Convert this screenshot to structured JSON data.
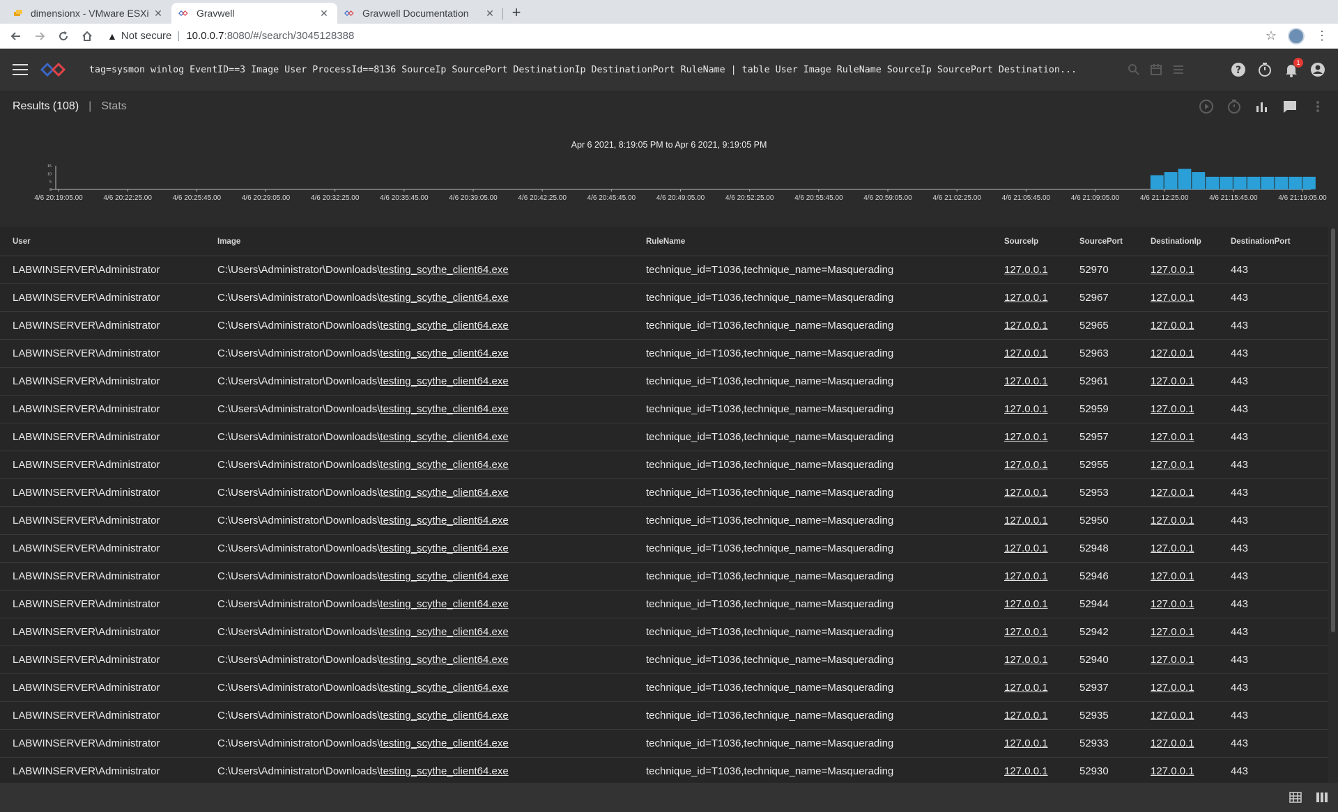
{
  "browser": {
    "tabs": [
      {
        "title": "dimensionx - VMware ESXi",
        "active": false
      },
      {
        "title": "Gravwell",
        "active": true
      },
      {
        "title": "Gravwell Documentation",
        "active": false
      }
    ],
    "new_tab": "+",
    "address": {
      "security": "Not secure",
      "host": "10.0.0.7",
      "path": ":8080/#/search/3045128388"
    }
  },
  "app": {
    "query": "tag=sysmon winlog EventID==3 Image User ProcessId==8136 SourceIp SourcePort DestinationIp DestinationPort RuleName | table User Image RuleName SourceIp SourcePort Destination...",
    "notification_count": "1",
    "colors": {
      "accent": "#2a9fd8",
      "logo_red": "#e2434b",
      "logo_blue": "#3a66c4"
    }
  },
  "results_bar": {
    "results_label": "Results (108)",
    "divider": "|",
    "stats_label": "Stats"
  },
  "overview": {
    "range_label": "Apr 6 2021, 8:19:05 PM to Apr 6 2021, 9:19:05 PM"
  },
  "chart_data": {
    "type": "bar",
    "title": "Apr 6 2021, 8:19:05 PM to Apr 6 2021, 9:19:05 PM",
    "xlabel": "",
    "ylabel": "",
    "y_ticks": [
      "15",
      "10",
      "5",
      "0"
    ],
    "ylim": [
      0,
      15
    ],
    "x_tick_labels": [
      "4/6 20:19:05.00",
      "4/6 20:22:25.00",
      "4/6 20:25:45.00",
      "4/6 20:29:05.00",
      "4/6 20:32:25.00",
      "4/6 20:35:45.00",
      "4/6 20:39:05.00",
      "4/6 20:42:25.00",
      "4/6 20:45:45.00",
      "4/6 20:49:05.00",
      "4/6 20:52:25.00",
      "4/6 20:55:45.00",
      "4/6 20:59:05.00",
      "4/6 21:02:25.00",
      "4/6 21:05:45.00",
      "4/6 21:09:05.00",
      "4/6 21:12:25.00",
      "4/6 21:15:45.00",
      "4/6 21:19:05.00"
    ],
    "bins_total": 90,
    "first_nonzero_bin": 79,
    "values": [
      9,
      11,
      13,
      11,
      8,
      8,
      8,
      8,
      8,
      8,
      8,
      8
    ],
    "color": "#2a9fd8"
  },
  "table": {
    "columns": [
      "User",
      "Image",
      "RuleName",
      "SourceIp",
      "SourcePort",
      "DestinationIp",
      "DestinationPort"
    ],
    "image_prefix": "C:\\Users\\Administrator\\Downloads\\",
    "rows": [
      {
        "user": "LABWINSERVER\\Administrator",
        "image_file": "testing_scythe_client64.exe",
        "rule": "technique_id=T1036,technique_name=Masquerading",
        "sip": "127.0.0.1",
        "sport": "52970",
        "dip": "127.0.0.1",
        "dport": "443"
      },
      {
        "user": "LABWINSERVER\\Administrator",
        "image_file": "testing_scythe_client64.exe",
        "rule": "technique_id=T1036,technique_name=Masquerading",
        "sip": "127.0.0.1",
        "sport": "52967",
        "dip": "127.0.0.1",
        "dport": "443"
      },
      {
        "user": "LABWINSERVER\\Administrator",
        "image_file": "testing_scythe_client64.exe",
        "rule": "technique_id=T1036,technique_name=Masquerading",
        "sip": "127.0.0.1",
        "sport": "52965",
        "dip": "127.0.0.1",
        "dport": "443"
      },
      {
        "user": "LABWINSERVER\\Administrator",
        "image_file": "testing_scythe_client64.exe",
        "rule": "technique_id=T1036,technique_name=Masquerading",
        "sip": "127.0.0.1",
        "sport": "52963",
        "dip": "127.0.0.1",
        "dport": "443"
      },
      {
        "user": "LABWINSERVER\\Administrator",
        "image_file": "testing_scythe_client64.exe",
        "rule": "technique_id=T1036,technique_name=Masquerading",
        "sip": "127.0.0.1",
        "sport": "52961",
        "dip": "127.0.0.1",
        "dport": "443"
      },
      {
        "user": "LABWINSERVER\\Administrator",
        "image_file": "testing_scythe_client64.exe",
        "rule": "technique_id=T1036,technique_name=Masquerading",
        "sip": "127.0.0.1",
        "sport": "52959",
        "dip": "127.0.0.1",
        "dport": "443"
      },
      {
        "user": "LABWINSERVER\\Administrator",
        "image_file": "testing_scythe_client64.exe",
        "rule": "technique_id=T1036,technique_name=Masquerading",
        "sip": "127.0.0.1",
        "sport": "52957",
        "dip": "127.0.0.1",
        "dport": "443"
      },
      {
        "user": "LABWINSERVER\\Administrator",
        "image_file": "testing_scythe_client64.exe",
        "rule": "technique_id=T1036,technique_name=Masquerading",
        "sip": "127.0.0.1",
        "sport": "52955",
        "dip": "127.0.0.1",
        "dport": "443"
      },
      {
        "user": "LABWINSERVER\\Administrator",
        "image_file": "testing_scythe_client64.exe",
        "rule": "technique_id=T1036,technique_name=Masquerading",
        "sip": "127.0.0.1",
        "sport": "52953",
        "dip": "127.0.0.1",
        "dport": "443"
      },
      {
        "user": "LABWINSERVER\\Administrator",
        "image_file": "testing_scythe_client64.exe",
        "rule": "technique_id=T1036,technique_name=Masquerading",
        "sip": "127.0.0.1",
        "sport": "52950",
        "dip": "127.0.0.1",
        "dport": "443"
      },
      {
        "user": "LABWINSERVER\\Administrator",
        "image_file": "testing_scythe_client64.exe",
        "rule": "technique_id=T1036,technique_name=Masquerading",
        "sip": "127.0.0.1",
        "sport": "52948",
        "dip": "127.0.0.1",
        "dport": "443"
      },
      {
        "user": "LABWINSERVER\\Administrator",
        "image_file": "testing_scythe_client64.exe",
        "rule": "technique_id=T1036,technique_name=Masquerading",
        "sip": "127.0.0.1",
        "sport": "52946",
        "dip": "127.0.0.1",
        "dport": "443"
      },
      {
        "user": "LABWINSERVER\\Administrator",
        "image_file": "testing_scythe_client64.exe",
        "rule": "technique_id=T1036,technique_name=Masquerading",
        "sip": "127.0.0.1",
        "sport": "52944",
        "dip": "127.0.0.1",
        "dport": "443"
      },
      {
        "user": "LABWINSERVER\\Administrator",
        "image_file": "testing_scythe_client64.exe",
        "rule": "technique_id=T1036,technique_name=Masquerading",
        "sip": "127.0.0.1",
        "sport": "52942",
        "dip": "127.0.0.1",
        "dport": "443"
      },
      {
        "user": "LABWINSERVER\\Administrator",
        "image_file": "testing_scythe_client64.exe",
        "rule": "technique_id=T1036,technique_name=Masquerading",
        "sip": "127.0.0.1",
        "sport": "52940",
        "dip": "127.0.0.1",
        "dport": "443"
      },
      {
        "user": "LABWINSERVER\\Administrator",
        "image_file": "testing_scythe_client64.exe",
        "rule": "technique_id=T1036,technique_name=Masquerading",
        "sip": "127.0.0.1",
        "sport": "52937",
        "dip": "127.0.0.1",
        "dport": "443"
      },
      {
        "user": "LABWINSERVER\\Administrator",
        "image_file": "testing_scythe_client64.exe",
        "rule": "technique_id=T1036,technique_name=Masquerading",
        "sip": "127.0.0.1",
        "sport": "52935",
        "dip": "127.0.0.1",
        "dport": "443"
      },
      {
        "user": "LABWINSERVER\\Administrator",
        "image_file": "testing_scythe_client64.exe",
        "rule": "technique_id=T1036,technique_name=Masquerading",
        "sip": "127.0.0.1",
        "sport": "52933",
        "dip": "127.0.0.1",
        "dport": "443"
      },
      {
        "user": "LABWINSERVER\\Administrator",
        "image_file": "testing_scythe_client64.exe",
        "rule": "technique_id=T1036,technique_name=Masquerading",
        "sip": "127.0.0.1",
        "sport": "52930",
        "dip": "127.0.0.1",
        "dport": "443"
      }
    ]
  },
  "icons": [
    "menu-icon",
    "gravwell-logo",
    "search-icon",
    "calendar-icon",
    "list-icon",
    "help-icon",
    "timer-icon",
    "notifications-icon",
    "account-icon",
    "play-icon",
    "stopwatch-icon",
    "chart-icon",
    "comment-icon",
    "more-vert-icon",
    "table-view-icon",
    "column-view-icon"
  ]
}
